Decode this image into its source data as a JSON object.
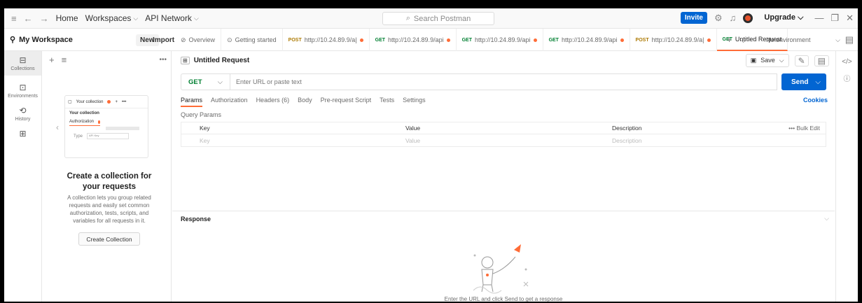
{
  "titlebar": {
    "menu_icon": "hamburger-icon",
    "nav": [
      "Home",
      "Workspaces",
      "API Network"
    ],
    "search_placeholder": "Search Postman",
    "invite_label": "Invite",
    "upgrade_label": "Upgrade"
  },
  "workspace": {
    "name": "My Workspace",
    "new_label": "New",
    "import_label": "Import"
  },
  "tabs": [
    {
      "method": "",
      "label": "Overview",
      "icon": "overview-icon"
    },
    {
      "method": "",
      "label": "Getting started",
      "icon": "getting-started-icon"
    },
    {
      "method": "POST",
      "label": "http://10.24.89.9/a|",
      "dirty": true
    },
    {
      "method": "GET",
      "label": "http://10.24.89.9/api",
      "dirty": true
    },
    {
      "method": "GET",
      "label": "http://10.24.89.9/api",
      "dirty": true
    },
    {
      "method": "GET",
      "label": "http://10.24.89.9/api",
      "dirty": true
    },
    {
      "method": "POST",
      "label": "http://10.24.89.9/a|",
      "dirty": true
    },
    {
      "method": "GET",
      "label": "Untitled Request",
      "active": true
    }
  ],
  "environment": "No environment",
  "rail": {
    "collections": "Collections",
    "environments": "Environments",
    "history": "History"
  },
  "preview": {
    "collection_name": "Your collection",
    "collection_title": "Your collection",
    "auth_label": "Authorization",
    "type_label": "Type",
    "type_value": "API Key"
  },
  "empty_state": {
    "title": "Create a collection for your requests",
    "description": "A collection lets you group related requests and easily set common authorization, tests, scripts, and variables for all requests in it.",
    "button": "Create Collection"
  },
  "request": {
    "title": "Untitled Request",
    "save_label": "Save",
    "method": "GET",
    "url_placeholder": "Enter URL or paste text",
    "send_label": "Send",
    "tabs": [
      "Params",
      "Authorization",
      "Headers (6)",
      "Body",
      "Pre-request Script",
      "Tests",
      "Settings"
    ],
    "cookies_label": "Cookies",
    "query_params_label": "Query Params",
    "columns": [
      "Key",
      "Value",
      "Description"
    ],
    "placeholders": [
      "Key",
      "Value",
      "Description"
    ],
    "bulk_edit": "Bulk Edit"
  },
  "response": {
    "label": "Response",
    "message": "Enter the URL and click Send to get a response"
  },
  "colors": {
    "accent": "#ff6c37",
    "primary": "#0265d2",
    "get": "#007f31",
    "post": "#ad7a03"
  }
}
